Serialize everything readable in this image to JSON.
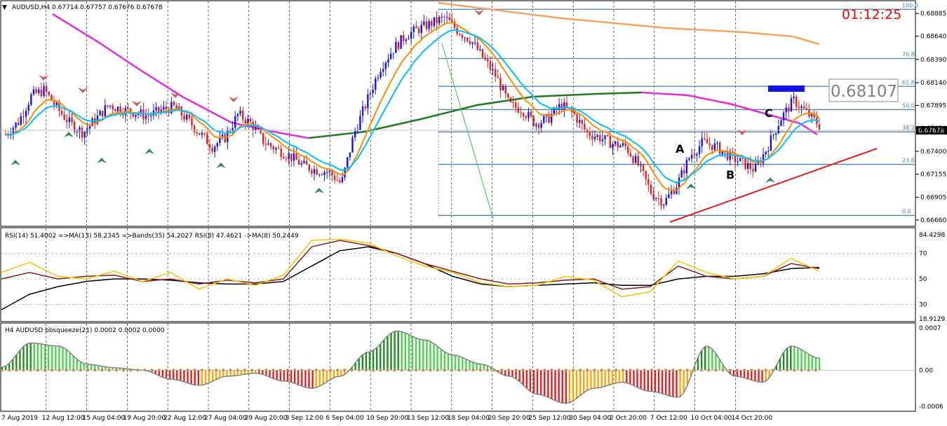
{
  "header": {
    "menu_icon": "triangle-down-icon",
    "symbol_line": "AUDUSD,H4  0.67714 0.67757 0.67676 0.67678",
    "timer": "01:12:25",
    "price_box": "0.68107",
    "current_price_tag": "0.67678",
    "timer_color": "#ff0000"
  },
  "price_axis_labels": [
    "0.68885",
    "0.68640",
    "0.68390",
    "0.68140",
    "0.67895",
    "0.67650",
    "0.67400",
    "0.67155",
    "0.66905",
    "0.66660"
  ],
  "fib_labels": [
    "100.0",
    "76.8",
    "61.8",
    "50.0",
    "38.2",
    "23.6",
    "0.0"
  ],
  "pattern_labels": {
    "a": "A",
    "b": "B",
    "c": "C"
  },
  "rsi_panel": {
    "title": "RSI(14) 51.4002  =>MA(13) 58.2345  =>Bands(35) 54.2027  RSI(8) 47.4621  ->MA(8) 50.2449",
    "axis_labels": [
      "84.4298",
      "70",
      "50",
      "30",
      "18.9129"
    ]
  },
  "bb_panel": {
    "title": "H4 AUDUSD bbsqueeze(21) 0.0002 0.0002 0.0000",
    "axis_labels": [
      "0.0007",
      "0.00",
      "-0.0006"
    ]
  },
  "time_labels": [
    "7 Aug 2019",
    "12 Aug 12:00",
    "15 Aug 04:00",
    "19 Aug 20:00",
    "22 Aug 12:00",
    "27 Aug 04:00",
    "29 Aug 20:00",
    "3 Sep 12:00",
    "6 Sep 04:00",
    "10 Sep 20:00",
    "13 Sep 12:00",
    "18 Sep 04:00",
    "20 Sep 20:00",
    "25 Sep 12:00",
    "30 Sep 04:00",
    "2 Oct 20:00",
    "7 Oct 12:00",
    "10 Oct 04:00",
    "14 Oct 20:00"
  ],
  "chart_data": {
    "type": "candlestick",
    "symbol": "AUDUSD",
    "timeframe": "H4",
    "ohlc_current": {
      "open": 0.67714,
      "high": 0.67757,
      "low": 0.67676,
      "close": 0.67678
    },
    "ylim": [
      0.666,
      0.69
    ],
    "close_series": [
      0.6758,
      0.6772,
      0.68,
      0.6806,
      0.6786,
      0.677,
      0.676,
      0.6775,
      0.679,
      0.6785,
      0.6782,
      0.6778,
      0.6784,
      0.6788,
      0.6775,
      0.676,
      0.6745,
      0.6755,
      0.678,
      0.677,
      0.675,
      0.6742,
      0.6735,
      0.6725,
      0.672,
      0.6718,
      0.6705,
      0.676,
      0.6795,
      0.683,
      0.685,
      0.6865,
      0.6872,
      0.6878,
      0.6884,
      0.687,
      0.686,
      0.684,
      0.682,
      0.679,
      0.6785,
      0.677,
      0.6775,
      0.679,
      0.678,
      0.676,
      0.6755,
      0.6748,
      0.6745,
      0.6725,
      0.6695,
      0.6685,
      0.6705,
      0.6735,
      0.675,
      0.6745,
      0.6735,
      0.6728,
      0.672,
      0.6745,
      0.6775,
      0.6795,
      0.6782,
      0.6768
    ],
    "fibonacci": [
      {
        "level": "100.0",
        "price": 0.6893
      },
      {
        "level": "76.8",
        "price": 0.684
      },
      {
        "level": "61.8",
        "price": 0.681
      },
      {
        "level": "50.0",
        "price": 0.6785
      },
      {
        "level": "38.2",
        "price": 0.6761
      },
      {
        "level": "23.6",
        "price": 0.6726
      },
      {
        "level": "0.0",
        "price": 0.6671
      }
    ],
    "rsi": {
      "ylim": [
        18.9129,
        84.4298
      ],
      "levels": [
        70,
        50,
        30
      ],
      "rsi8": [
        55,
        63,
        52,
        50,
        56,
        48,
        55,
        42,
        50,
        45,
        53,
        80,
        81,
        78,
        68,
        60,
        55,
        47,
        44,
        45,
        52,
        49,
        36,
        40,
        64,
        55,
        50,
        52,
        66,
        56
      ],
      "rsi14": [
        50,
        55,
        50,
        52,
        53,
        48,
        50,
        46,
        49,
        47,
        50,
        75,
        80,
        76,
        70,
        62,
        56,
        50,
        46,
        47,
        49,
        50,
        42,
        44,
        60,
        52,
        50,
        52,
        62,
        58
      ],
      "ma": [
        26,
        38,
        44,
        48,
        50,
        50,
        49,
        47,
        46,
        46,
        48,
        60,
        72,
        75,
        70,
        62,
        52,
        46,
        44,
        45,
        46,
        47,
        45,
        45,
        50,
        52,
        52,
        54,
        58,
        59
      ]
    },
    "bbsqueeze": {
      "ylim": [
        -0.0006,
        0.0007
      ],
      "values": [
        5e-05,
        0.00045,
        0.0004,
        0.0001,
        4e-05,
        0.0,
        -0.00015,
        -0.00025,
        -0.0001,
        -5e-05,
        -0.00018,
        -0.0003,
        -0.0001,
        0.0003,
        0.00065,
        0.0005,
        0.00025,
        0.0001,
        -0.0001,
        -0.0004,
        -0.00055,
        -0.0003,
        -0.0002,
        -0.00035,
        -0.00045,
        0.0004,
        -0.0001,
        -0.0002,
        0.0004,
        0.0002
      ]
    }
  }
}
